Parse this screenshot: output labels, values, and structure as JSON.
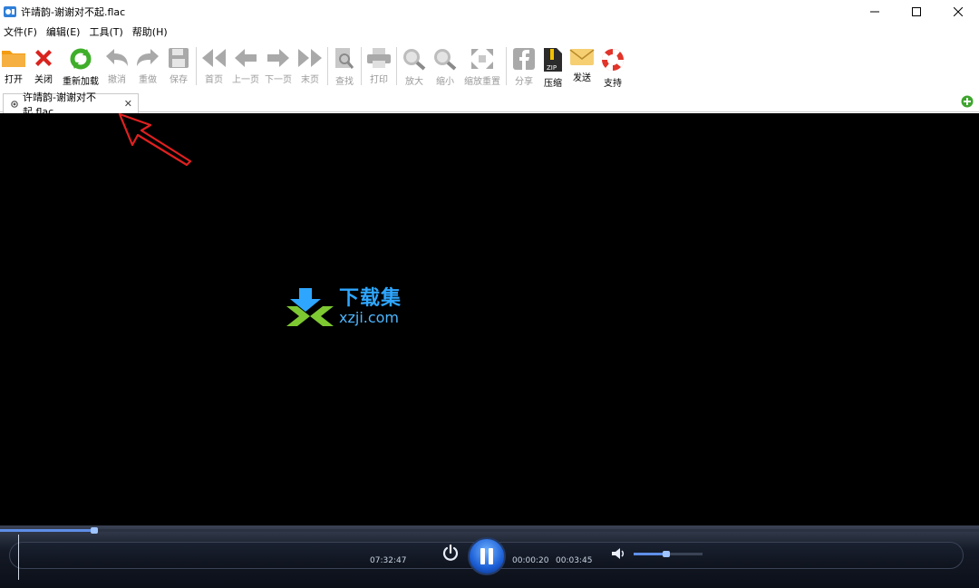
{
  "window": {
    "title": "许靖韵-谢谢对不起.flac"
  },
  "menu": [
    {
      "label": "文件(F)"
    },
    {
      "label": "编辑(E)"
    },
    {
      "label": "工具(T)"
    },
    {
      "label": "帮助(H)"
    }
  ],
  "toolbar": {
    "open": "打开",
    "close": "关闭",
    "reload": "重新加载",
    "undo": "撤消",
    "redo": "重做",
    "save": "保存",
    "first_page": "首页",
    "prev_page": "上一页",
    "next_page": "下一页",
    "last_page": "末页",
    "find": "查找",
    "print": "打印",
    "zoom_in": "放大",
    "zoom_out": "缩小",
    "zoom_reset": "缩放重置",
    "share": "分享",
    "compress": "压缩",
    "send": "发送",
    "support": "支持"
  },
  "tab": {
    "label": "许靖韵-谢谢对不起.flac",
    "close_glyph": "✕"
  },
  "watermark": {
    "cn": "下载集",
    "url": "xzji.com"
  },
  "player": {
    "total_time": "07:32:47",
    "elapsed": "00:00:20",
    "duration": "00:03:45",
    "seek_progress": 0.096,
    "volume_level": 0.47
  },
  "colors": {
    "accent_blue": "#1c5fd6",
    "annotation_red": "#e02020",
    "content_bg": "#000000"
  }
}
